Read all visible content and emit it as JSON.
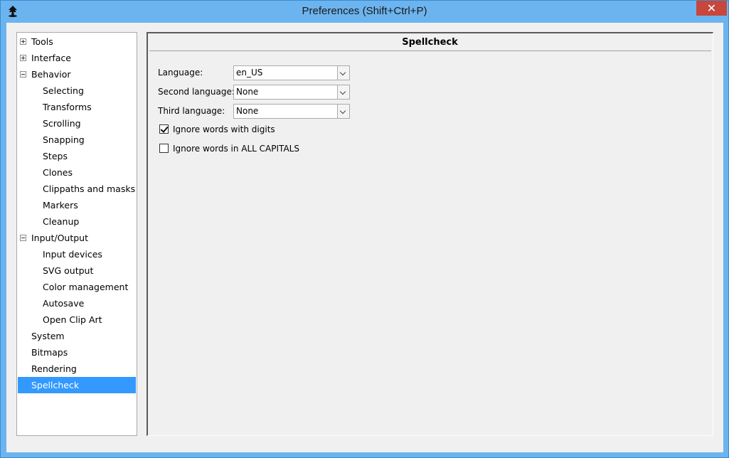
{
  "window": {
    "title": "Preferences (Shift+Ctrl+P)",
    "close_label": "✕",
    "app_icon": "inkscape-icon"
  },
  "tree": {
    "items": [
      {
        "label": "Tools",
        "level": 0,
        "expander": "plus"
      },
      {
        "label": "Interface",
        "level": 0,
        "expander": "plus"
      },
      {
        "label": "Behavior",
        "level": 0,
        "expander": "minus"
      },
      {
        "label": "Selecting",
        "level": 1
      },
      {
        "label": "Transforms",
        "level": 1
      },
      {
        "label": "Scrolling",
        "level": 1
      },
      {
        "label": "Snapping",
        "level": 1
      },
      {
        "label": "Steps",
        "level": 1
      },
      {
        "label": "Clones",
        "level": 1
      },
      {
        "label": "Clippaths and masks",
        "level": 1
      },
      {
        "label": "Markers",
        "level": 1
      },
      {
        "label": "Cleanup",
        "level": 1
      },
      {
        "label": "Input/Output",
        "level": 0,
        "expander": "minus"
      },
      {
        "label": "Input devices",
        "level": 1
      },
      {
        "label": "SVG output",
        "level": 1
      },
      {
        "label": "Color management",
        "level": 1
      },
      {
        "label": "Autosave",
        "level": 1
      },
      {
        "label": "Open Clip Art",
        "level": 1
      },
      {
        "label": "System",
        "level": 0
      },
      {
        "label": "Bitmaps",
        "level": 0
      },
      {
        "label": "Rendering",
        "level": 0
      },
      {
        "label": "Spellcheck",
        "level": 0,
        "selected": true
      }
    ]
  },
  "panel": {
    "title": "Spellcheck",
    "language_label": "Language:",
    "language_value": "en_US",
    "second_language_label": "Second language:",
    "second_language_value": "None",
    "third_language_label": "Third language:",
    "third_language_value": "None",
    "ignore_digits_label": "Ignore words with digits",
    "ignore_digits_checked": true,
    "ignore_caps_label": "Ignore words in ALL CAPITALS",
    "ignore_caps_checked": false
  },
  "colors": {
    "title_bar": "#6cb4ef",
    "selection": "#3399ff",
    "close_button": "#c7473d"
  }
}
